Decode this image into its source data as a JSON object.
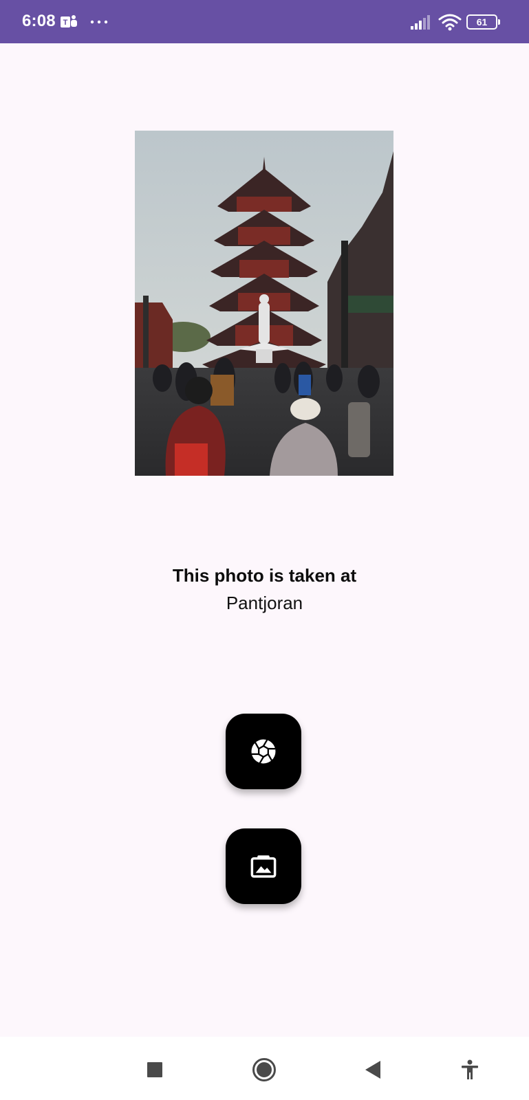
{
  "status_bar": {
    "time": "6:08",
    "battery_level": "61",
    "background_color": "#6750a4",
    "icons": [
      "teams-icon",
      "more-dots-icon",
      "signal-icon",
      "wifi-icon",
      "battery-icon"
    ]
  },
  "photo": {
    "subject": "pagoda-photo"
  },
  "caption": {
    "title": "This photo is taken at",
    "location": "Pantjoran"
  },
  "actions": {
    "camera_icon": "camera-shutter-icon",
    "gallery_icon": "gallery-image-icon"
  },
  "nav_bar": {
    "icons": [
      "recents-square-icon",
      "home-circle-icon",
      "back-triangle-icon",
      "accessibility-icon"
    ]
  }
}
